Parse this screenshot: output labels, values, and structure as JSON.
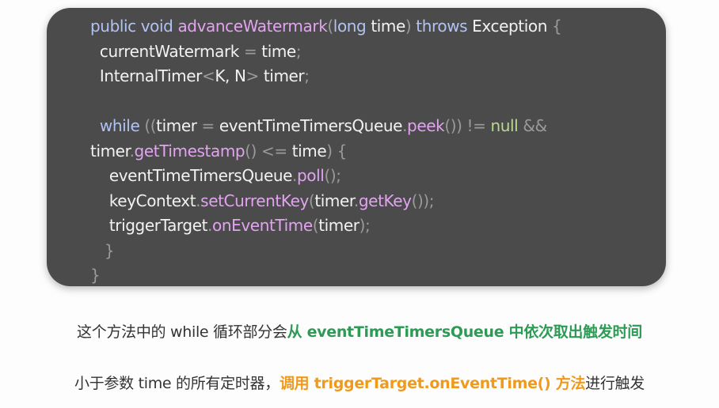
{
  "colors": {
    "card_background": "#4b4b4b",
    "keyword": "#b1c3f2",
    "method": "#e2a3f0",
    "null_literal": "#b9d98e",
    "punctuation": "#9a9a9a",
    "plain": "#f2f2f2",
    "caption_text": "#333333",
    "caption_highlight_green": "#2d9b55",
    "caption_highlight_orange": "#f09a1d"
  },
  "code_lines": [
    [
      [
        "public void",
        "kw"
      ],
      [
        " ",
        "def"
      ],
      [
        "advanceWatermark",
        "fn"
      ],
      [
        "(",
        "dim"
      ],
      [
        "long",
        "kw"
      ],
      [
        " time",
        "def"
      ],
      [
        ")",
        "dim"
      ],
      [
        " ",
        "def"
      ],
      [
        "throws",
        "kw"
      ],
      [
        " Exception ",
        "def"
      ],
      [
        "{",
        "dim"
      ]
    ],
    [
      [
        "  currentWatermark ",
        "def"
      ],
      [
        "=",
        "dim"
      ],
      [
        " time",
        "def"
      ],
      [
        ";",
        "dim"
      ]
    ],
    [
      [
        "  InternalTimer",
        "def"
      ],
      [
        "<",
        "dim"
      ],
      [
        "K, N",
        "def"
      ],
      [
        ">",
        "dim"
      ],
      [
        " timer",
        "def"
      ],
      [
        ";",
        "dim"
      ]
    ],
    [
      [
        "",
        "def"
      ]
    ],
    [
      [
        "  ",
        "def"
      ],
      [
        "while",
        "kw"
      ],
      [
        " ",
        "def"
      ],
      [
        "((",
        "dim"
      ],
      [
        "timer ",
        "def"
      ],
      [
        "=",
        "dim"
      ],
      [
        " eventTimeTimersQueue",
        "def"
      ],
      [
        ".",
        "dim"
      ],
      [
        "peek",
        "fn"
      ],
      [
        "())",
        "dim"
      ],
      [
        " ",
        "def"
      ],
      [
        "!=",
        "dim"
      ],
      [
        " ",
        "def"
      ],
      [
        "null",
        "null"
      ],
      [
        " ",
        "def"
      ],
      [
        "&&",
        "dim"
      ]
    ],
    [
      [
        "timer",
        "def"
      ],
      [
        ".",
        "dim"
      ],
      [
        "getTimestamp",
        "fn"
      ],
      [
        "()",
        "dim"
      ],
      [
        " ",
        "def"
      ],
      [
        "<=",
        "dim"
      ],
      [
        " time",
        "def"
      ],
      [
        ")",
        "dim"
      ],
      [
        " ",
        "def"
      ],
      [
        "{",
        "dim"
      ]
    ],
    [
      [
        "    eventTimeTimersQueue",
        "def"
      ],
      [
        ".",
        "dim"
      ],
      [
        "poll",
        "fn"
      ],
      [
        "()",
        "dim"
      ],
      [
        ";",
        "dim"
      ]
    ],
    [
      [
        "    keyContext",
        "def"
      ],
      [
        ".",
        "dim"
      ],
      [
        "setCurrentKey",
        "fn"
      ],
      [
        "(",
        "dim"
      ],
      [
        "timer",
        "def"
      ],
      [
        ".",
        "dim"
      ],
      [
        "getKey",
        "fn"
      ],
      [
        "())",
        "dim"
      ],
      [
        ";",
        "dim"
      ]
    ],
    [
      [
        "    triggerTarget",
        "def"
      ],
      [
        ".",
        "dim"
      ],
      [
        "onEventTime",
        "fn"
      ],
      [
        "(",
        "dim"
      ],
      [
        "timer",
        "def"
      ],
      [
        ")",
        "dim"
      ],
      [
        ";",
        "dim"
      ]
    ],
    [
      [
        "   ",
        "def"
      ],
      [
        "}",
        "dim"
      ]
    ],
    [
      [
        "",
        "def"
      ],
      [
        "}",
        "dim"
      ]
    ]
  ],
  "captions": {
    "line1": {
      "plain": "这个方法中的 while 循环部分会",
      "highlight": "从 eventTimeTimersQueue 中依次取出触发时间"
    },
    "line2": {
      "plain_before": "小于参数 time 的所有定时器，",
      "highlight": "调用 triggerTarget.onEventTime() 方法",
      "plain_after": "进行触发"
    }
  }
}
